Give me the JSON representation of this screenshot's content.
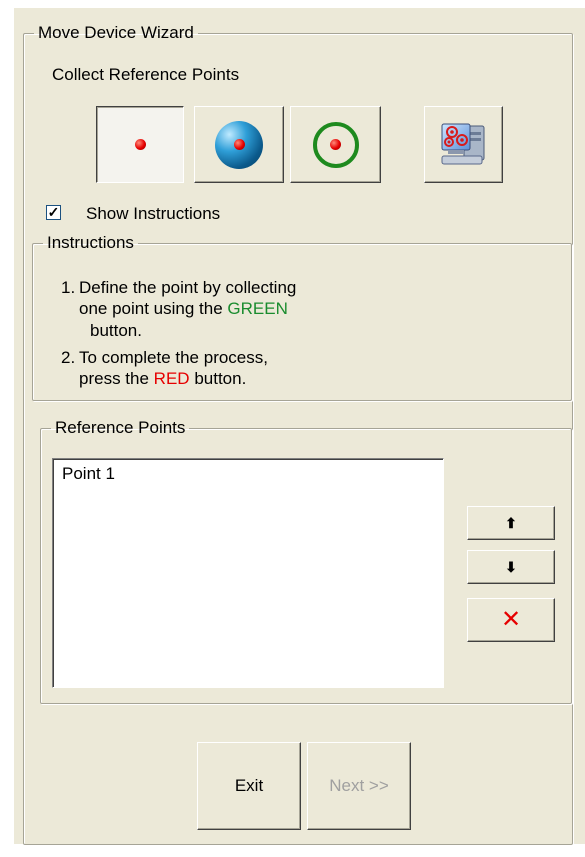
{
  "wizard": {
    "title": "Move Device Wizard",
    "step_title": "Collect Reference Points"
  },
  "toolbar": {
    "buttons": [
      {
        "icon": "red-point-icon"
      },
      {
        "icon": "blue-sphere-point-icon"
      },
      {
        "icon": "green-circle-point-icon"
      },
      {
        "icon": "device-computer-icon"
      }
    ]
  },
  "show_instructions": {
    "label": "Show Instructions",
    "checked": true,
    "check_mark": "✓"
  },
  "instructions": {
    "title": "Instructions",
    "step1": {
      "num": "1.",
      "line1": "Define the point by collecting",
      "line2": "one point using the",
      "highlight": "GREEN",
      "line3": "button."
    },
    "step2": {
      "num": "2.",
      "line1": "To complete the process,",
      "line2": "press the",
      "highlight": "RED",
      "line3": "button."
    }
  },
  "reference_points": {
    "title": "Reference Points",
    "items": [
      "Point 1"
    ],
    "move_up_icon": "⬆",
    "move_down_icon": "⬇",
    "delete_icon": "✕"
  },
  "footer": {
    "exit_label": "Exit",
    "next_label": "Next >>"
  },
  "colors": {
    "green_text": "#1a8c2e",
    "red_text": "#e60000",
    "dialog_bg": "#ece9d8"
  }
}
